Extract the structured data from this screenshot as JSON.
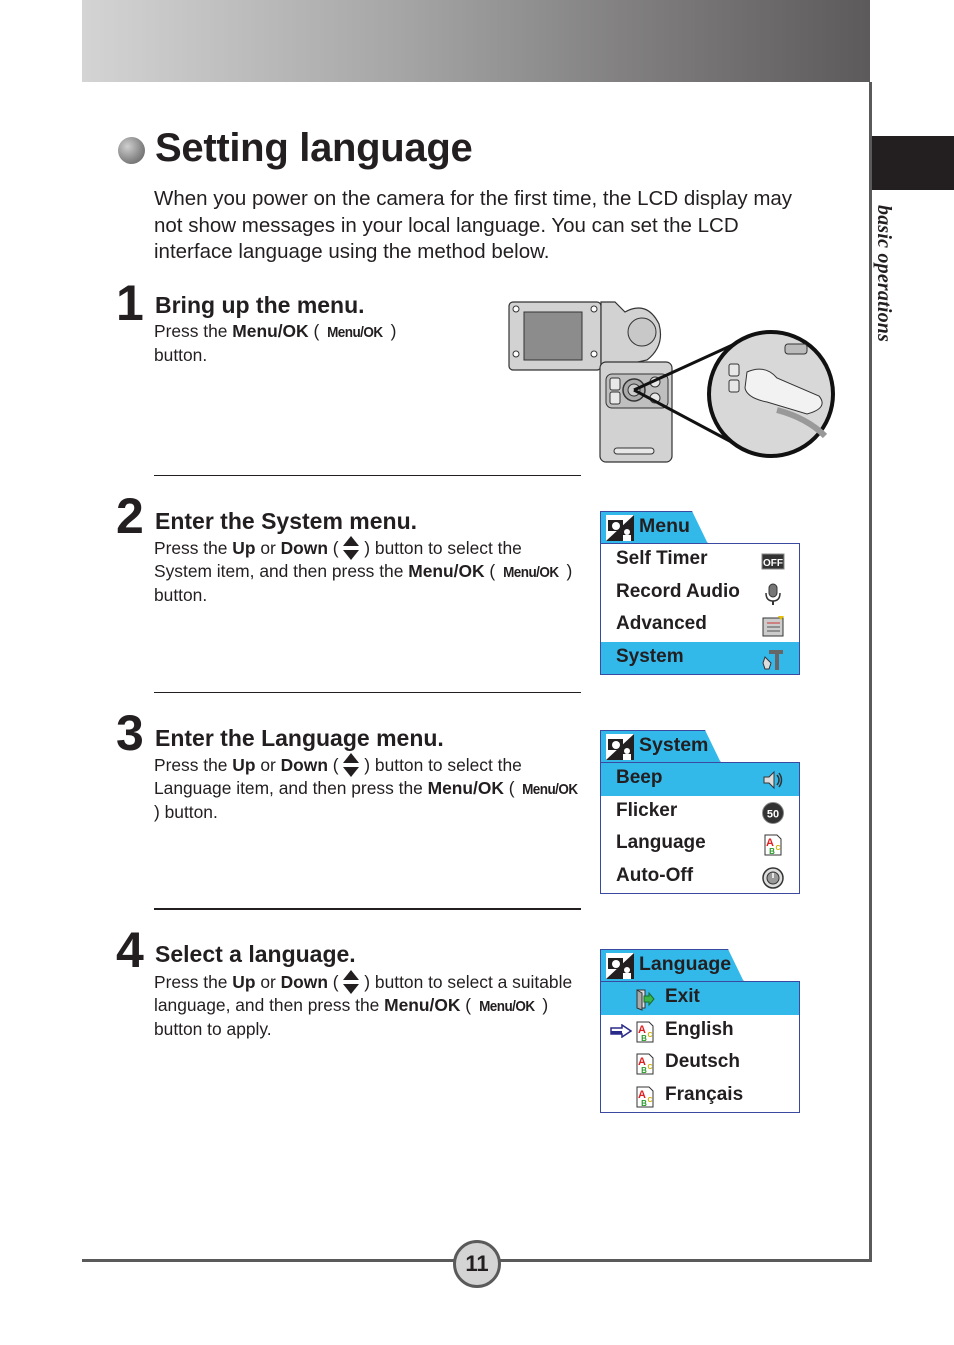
{
  "page": {
    "section_label": "basic operations",
    "page_number": "11"
  },
  "heading": {
    "title": "Setting language",
    "intro": "When you power on the camera for the first time, the LCD display may not show messages in your local language. You can set the LCD interface language using the method below."
  },
  "steps": [
    {
      "number": "1",
      "title": "Bring up the menu.",
      "body": {
        "t1": "Press the ",
        "b1": "Menu/OK",
        "t2": " ( ",
        "key": "Menu/OK",
        "t3": " ) button."
      },
      "illustration": "camera-menu-ok-button-press"
    },
    {
      "number": "2",
      "title": "Enter the System menu.",
      "body": {
        "t1": "Press the ",
        "b1": "Up",
        "t2": " or ",
        "b2": "Down",
        "t3": " ( ",
        "t4": " ) button to select the System item, and then press the ",
        "b3": "Menu/OK",
        "t5": " ( ",
        "key": "Menu/OK",
        "t6": " ) button."
      }
    },
    {
      "number": "3",
      "title": "Enter the Language menu.",
      "body": {
        "t1": "Press the ",
        "b1": "Up",
        "t2": " or ",
        "b2": "Down",
        "t3": " ( ",
        "t4": " ) button to select the Language item, and then press the ",
        "b3": "Menu/OK",
        "t5": " ( ",
        "key": "Menu/OK",
        "t6": " ) button."
      }
    },
    {
      "number": "4",
      "title": "Select a language.",
      "body": {
        "t1": "Press the ",
        "b1": "Up",
        "t2": " or ",
        "b2": "Down",
        "t3": " ( ",
        "t4": " ) button to select a suitable language, and then press the ",
        "b3": "Menu/OK",
        "t5": " ( ",
        "key": "Menu/OK",
        "t6": " ) button to apply."
      }
    }
  ],
  "lcd_menus": {
    "menu": {
      "tab_label": "Menu",
      "tab_icon": "camera-person-icon",
      "items": [
        {
          "label": "Self Timer",
          "icon": "off-badge-icon",
          "selected": false
        },
        {
          "label": "Record Audio",
          "icon": "microphone-icon",
          "selected": false
        },
        {
          "label": "Advanced",
          "icon": "list-document-icon",
          "selected": false
        },
        {
          "label": "System",
          "icon": "tools-icon",
          "selected": true
        }
      ]
    },
    "system": {
      "tab_label": "System",
      "tab_icon": "camera-person-icon",
      "items": [
        {
          "label": "Beep",
          "icon": "speaker-icon",
          "selected": true
        },
        {
          "label": "Flicker",
          "icon": "50hz-icon",
          "selected": false,
          "icon_text": "50"
        },
        {
          "label": "Language",
          "icon": "abc-document-icon",
          "selected": false
        },
        {
          "label": "Auto-Off",
          "icon": "timer-icon",
          "selected": false
        }
      ]
    },
    "language": {
      "tab_label": "Language",
      "tab_icon": "camera-person-icon",
      "items": [
        {
          "label": "Exit",
          "icon": "exit-door-icon",
          "selected": true,
          "current": false
        },
        {
          "label": "English",
          "icon": "abc-document-icon",
          "selected": false,
          "current": true
        },
        {
          "label": "Deutsch",
          "icon": "abc-document-icon",
          "selected": false,
          "current": false
        },
        {
          "label": "Français",
          "icon": "abc-document-icon",
          "selected": false,
          "current": false
        }
      ]
    }
  },
  "colors": {
    "lcd_highlight": "#33b8ea",
    "lcd_border": "#3a4aa0",
    "text": "#231f20",
    "rule": "#5a5a5a"
  }
}
